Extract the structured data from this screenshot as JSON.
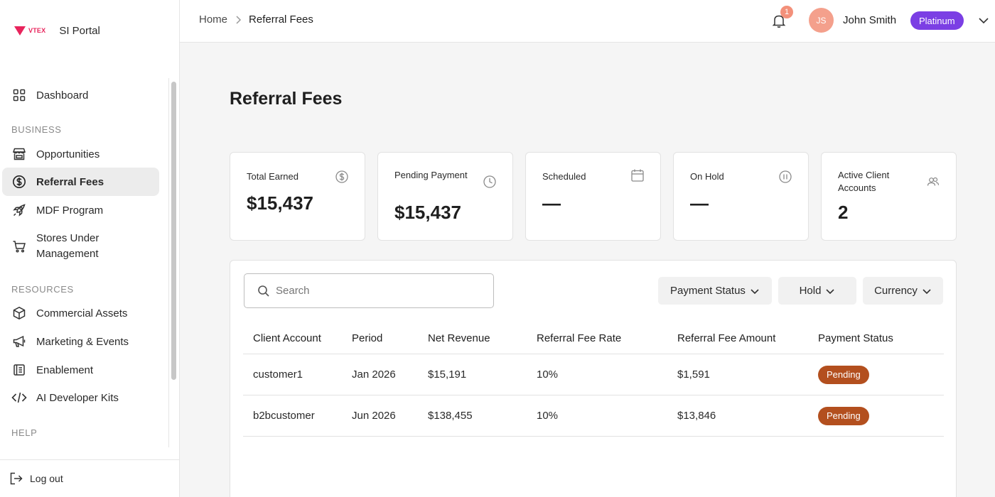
{
  "brand": {
    "logo_text": "VTEX",
    "title": "SI Portal"
  },
  "sidebar": {
    "top_items": [
      {
        "label": "Dashboard",
        "icon": "grid-icon"
      }
    ],
    "sections": {
      "business": "BUSINESS",
      "resources": "RESOURCES",
      "help": "HELP"
    },
    "business_items": [
      {
        "label": "Opportunities",
        "icon": "storefront-icon"
      },
      {
        "label": "Referral Fees",
        "icon": "dollar-circle-icon",
        "active": true
      },
      {
        "label": "MDF Program",
        "icon": "rocket-icon"
      },
      {
        "label": "Stores Under Management",
        "icon": "cart-icon"
      }
    ],
    "resources_items": [
      {
        "label": "Commercial Assets",
        "icon": "box-icon"
      },
      {
        "label": "Marketing & Events",
        "icon": "megaphone-icon"
      },
      {
        "label": "Enablement",
        "icon": "document-icon"
      },
      {
        "label": "AI Developer Kits",
        "icon": "code-icon"
      }
    ],
    "logout": "Log out"
  },
  "header": {
    "breadcrumb": {
      "home": "Home",
      "current": "Referral Fees"
    },
    "notifications_count": "1",
    "user": {
      "initials": "JS",
      "name": "John Smith",
      "tier": "Platinum"
    }
  },
  "page": {
    "title": "Referral Fees"
  },
  "stats": [
    {
      "label": "Total Earned",
      "value": "$15,437",
      "icon": "dollar-circle-icon"
    },
    {
      "label": "Pending Payment",
      "value": "$15,437",
      "icon": "clock-icon"
    },
    {
      "label": "Scheduled",
      "value": "—",
      "icon": "calendar-icon"
    },
    {
      "label": "On Hold",
      "value": "—",
      "icon": "pause-circle-icon"
    },
    {
      "label": "Active Client Accounts",
      "value": "2",
      "icon": "users-icon"
    }
  ],
  "filters": {
    "search_placeholder": "Search",
    "payment_status": "Payment Status",
    "hold": "Hold",
    "currency": "Currency"
  },
  "table": {
    "columns": [
      "Client Account",
      "Period",
      "Net Revenue",
      "Referral Fee Rate",
      "Referral Fee Amount",
      "Payment Status"
    ],
    "rows": [
      {
        "client": "customer1",
        "period": "Jan 2026",
        "net_revenue": "$15,191",
        "rate": "10%",
        "amount": "$1,591",
        "status": "Pending"
      },
      {
        "client": "b2bcustomer",
        "period": "Jun 2026",
        "net_revenue": "$138,455",
        "rate": "10%",
        "amount": "$13,846",
        "status": "Pending"
      }
    ]
  },
  "colors": {
    "brand": "#e8245c",
    "tier_badge": "#7b3fe4",
    "avatar": "#f4a08c",
    "pending_pill": "#b34f1e"
  }
}
